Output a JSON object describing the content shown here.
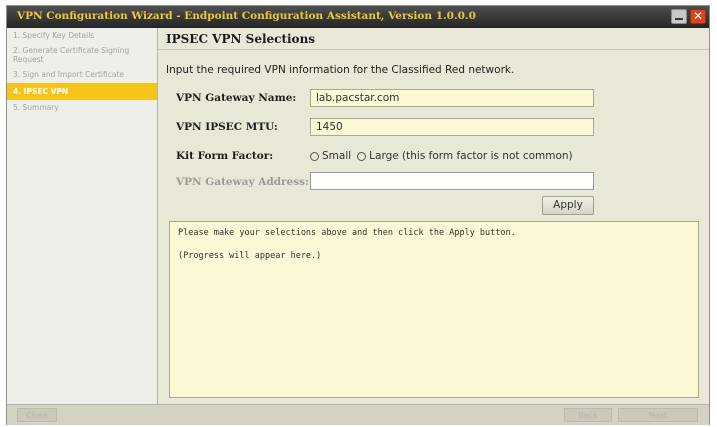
{
  "window": {
    "title": "VPN Configuration Wizard - Endpoint Configuration Assistant, Version 1.0.0.0",
    "minimize_icon": "minimize-icon",
    "close_icon": "close-icon",
    "close_glyph": "✕"
  },
  "sidebar": {
    "steps": [
      {
        "label": "1. Specify Key Details",
        "active": false
      },
      {
        "label": "2. Generate Certificate Signing Request",
        "active": false
      },
      {
        "label": "3. Sign and Import Certificate",
        "active": false
      },
      {
        "label": "4. IPSEC VPN",
        "active": true
      },
      {
        "label": "5. Summary",
        "active": false
      }
    ]
  },
  "main": {
    "heading": "IPSEC VPN Selections",
    "instructions": "Input the required VPN information for the Classified Red network.",
    "gateway_name": {
      "label": "VPN Gateway Name:",
      "value": "lab.pacstar.com"
    },
    "ipsec_mtu": {
      "label": "VPN IPSEC MTU:",
      "value": "1450"
    },
    "kit_form_factor": {
      "label": "Kit Form Factor:",
      "options": [
        "Small",
        "Large (this form factor is not common)"
      ],
      "selected": "none"
    },
    "gateway_address": {
      "label": "VPN Gateway Address:",
      "value": ""
    },
    "apply_label": "Apply",
    "progress_lines": [
      "Please make your selections above and then click the Apply button.",
      "(Progress will appear here.)"
    ]
  },
  "footer": {
    "close_label": "Close",
    "back_label": "Back",
    "next_label": "Next"
  },
  "colors": {
    "accent": "#f6c51b",
    "title_text": "#f0c93a",
    "field_bg": "#fbf8d6"
  }
}
